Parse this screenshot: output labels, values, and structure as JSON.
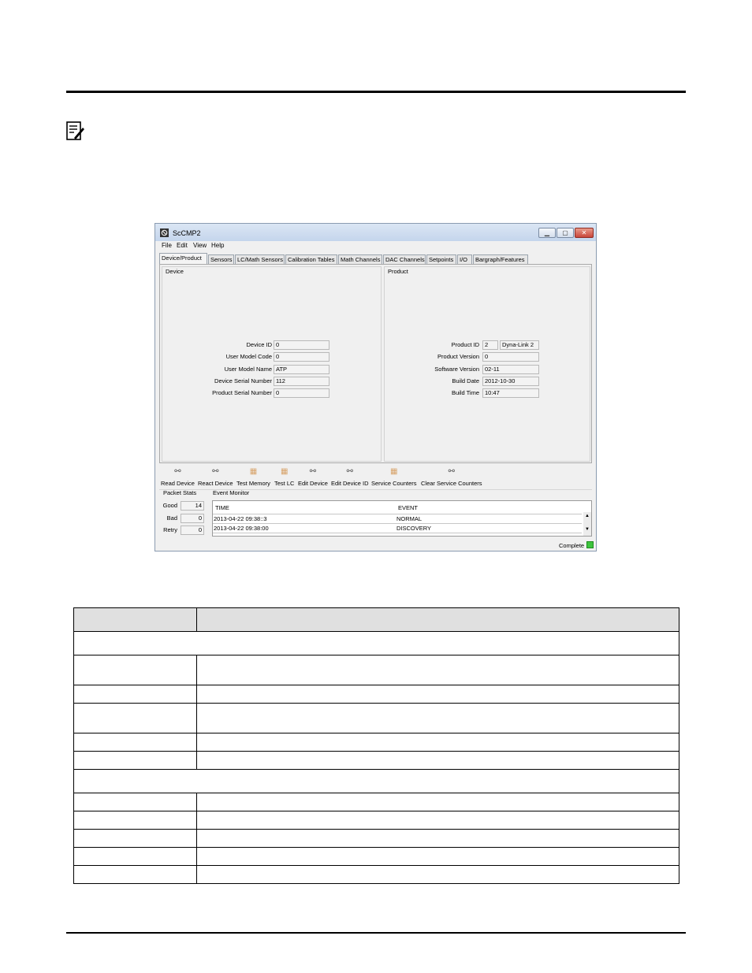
{
  "window": {
    "title": "ScCMP2",
    "controls": {
      "minimize": "▁",
      "maximize": "▢",
      "close": "✕"
    }
  },
  "menu": [
    "File",
    "Edit",
    "View",
    "Help"
  ],
  "tabs": [
    {
      "label": "Device/Product",
      "active": true
    },
    {
      "label": "Sensors"
    },
    {
      "label": "LC/Math Sensors"
    },
    {
      "label": "Calibration Tables"
    },
    {
      "label": "Math Channels"
    },
    {
      "label": "DAC Channels"
    },
    {
      "label": "Setpoints"
    },
    {
      "label": "I/O"
    },
    {
      "label": "Bargraph/Features"
    }
  ],
  "device": {
    "title": "Device",
    "fields": [
      {
        "label": "Device ID",
        "value": "0"
      },
      {
        "label": "User Model Code",
        "value": "0"
      },
      {
        "label": "User Model Name",
        "value": "ATP"
      },
      {
        "label": "Device Serial Number",
        "value": "112"
      },
      {
        "label": "Product Serial Number",
        "value": "0"
      }
    ]
  },
  "product": {
    "title": "Product",
    "product_id": "2",
    "product_name": "Dyna-Link 2",
    "fields": [
      {
        "label": "Product ID",
        "value": "2"
      },
      {
        "label": "Product Version",
        "value": "0"
      },
      {
        "label": "Software Version",
        "value": "02-11"
      },
      {
        "label": "Build Date",
        "value": "2012-10-30"
      },
      {
        "label": "Build Time",
        "value": "10:47"
      }
    ]
  },
  "toolbar": [
    "Read Device",
    "React Device",
    "Test Memory",
    "Test LC",
    "Edit Device",
    "Edit Device ID",
    "Service Counters",
    "Clear Service Counters"
  ],
  "packet_stats": {
    "title": "Packet Stats",
    "rows": [
      {
        "label": "Good",
        "value": "14"
      },
      {
        "label": "Bad",
        "value": "0"
      },
      {
        "label": "Retry",
        "value": "0"
      }
    ]
  },
  "event_monitor": {
    "title": "Event Monitor",
    "columns": [
      "TIME",
      "EVENT"
    ],
    "rows": [
      {
        "time": "2013-04-22 09:38::3",
        "event": "NORMAL"
      },
      {
        "time": "2013-04-22 09:38:00",
        "event": "DISCOVERY"
      }
    ],
    "scroll_up": "▲",
    "scroll_down": "▼"
  },
  "status": "Complete",
  "colors": {
    "status_ok": "#3ec43e"
  }
}
